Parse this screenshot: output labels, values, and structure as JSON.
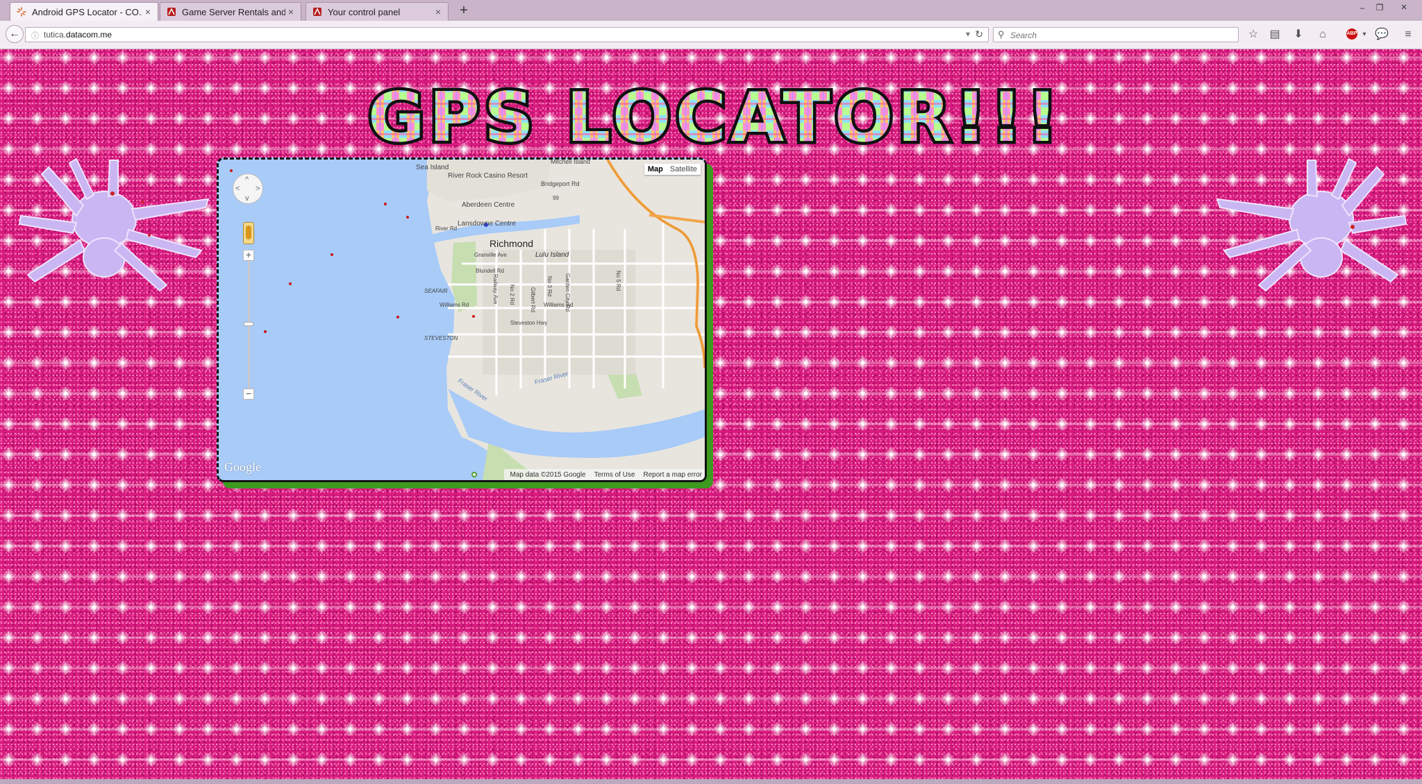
{
  "browser": {
    "tabs": [
      {
        "title": "Android GPS Locator - CO...",
        "active": true
      },
      {
        "title": "Game Server Rentals and H...",
        "active": false
      },
      {
        "title": "Your control panel",
        "active": false
      }
    ],
    "new_tab_label": "+",
    "url_host": "tutica.",
    "url_domain": "datacom.me",
    "search_placeholder": "Search",
    "abp_label": "ABP"
  },
  "page": {
    "heading": "GPS LOCATOR!!!",
    "background_color": "#d81b7e"
  },
  "map": {
    "type_controls": {
      "map": "Map",
      "satellite": "Satellite"
    },
    "zoom_in": "+",
    "zoom_out": "−",
    "watermark": "Google",
    "footer": {
      "data": "Map data ©2015 Google",
      "terms": "Terms of Use",
      "report": "Report a map error"
    },
    "labels": {
      "sea_island": "Sea Island",
      "mitchell": "Mitchell Island",
      "casino": "River Rock Casino Resort",
      "bridgeport": "Bridgeport Rd",
      "aberdeen": "Aberdeen Centre",
      "lansdowne": "Lansdowne Centre",
      "river_rd": "River Rd",
      "richmond": "Richmond",
      "lulu": "Lulu Island",
      "granville": "Granville Ave",
      "blundell": "Blundell Rd",
      "no2": "No 2 Rd",
      "no3": "No 3 Rd",
      "no5": "No 5 Rd",
      "gilbert": "Gilbert Rd",
      "garden_city": "Garden City Rd",
      "railway": "Railway Ave",
      "seafair": "SEAFAIR",
      "williams_w": "Williams Rd",
      "williams_e": "Williams Rd",
      "steveston_hwy": "Steveston Hwy",
      "steveston": "STEVESTON",
      "fraser1": "Fraser River",
      "fraser2": "Fraser River",
      "hwy99": "99"
    }
  }
}
